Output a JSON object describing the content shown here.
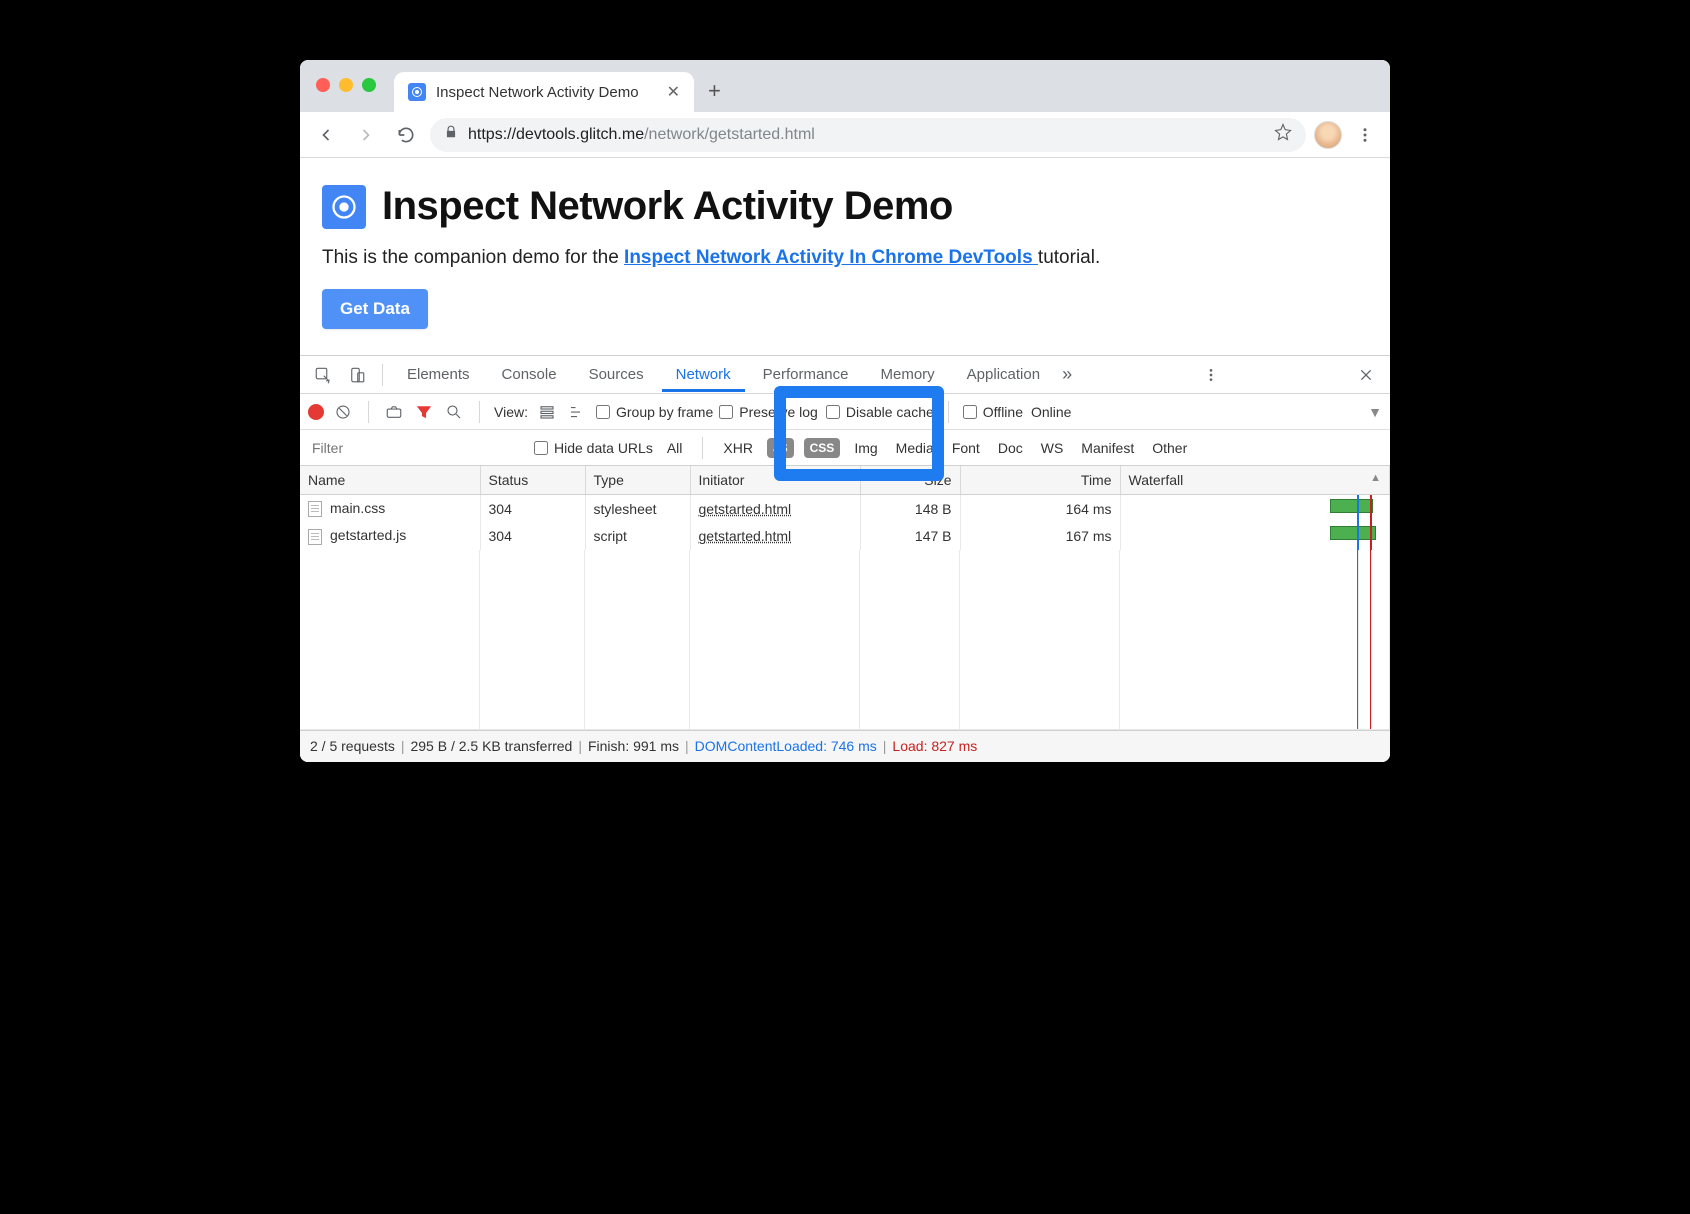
{
  "browser": {
    "tab_title": "Inspect Network Activity Demo",
    "url_host": "https://devtools.glitch.me",
    "url_path": "/network/getstarted.html"
  },
  "page": {
    "heading": "Inspect Network Activity Demo",
    "intro_prefix": "This is the companion demo for the ",
    "intro_link": "Inspect Network Activity In Chrome DevTools ",
    "intro_suffix": "tutorial.",
    "button_label": "Get Data"
  },
  "devtools": {
    "tabs": [
      "Elements",
      "Console",
      "Sources",
      "Network",
      "Performance",
      "Memory",
      "Application"
    ],
    "active_tab": "Network",
    "controls": {
      "view_label": "View:",
      "group_by_frame": "Group by frame",
      "preserve_log": "Preserve log",
      "disable_cache": "Disable cache",
      "offline": "Offline",
      "online": "Online"
    },
    "filters": {
      "placeholder": "Filter",
      "hide_data_urls": "Hide data URLs",
      "types": [
        "All",
        "XHR",
        "JS",
        "CSS",
        "Img",
        "Media",
        "Font",
        "Doc",
        "WS",
        "Manifest",
        "Other"
      ],
      "selected": [
        "JS",
        "CSS"
      ]
    },
    "columns": [
      "Name",
      "Status",
      "Type",
      "Initiator",
      "Size",
      "Time",
      "Waterfall"
    ],
    "rows": [
      {
        "name": "main.css",
        "status": "304",
        "type": "stylesheet",
        "initiator": "getstarted.html",
        "size": "148 B",
        "time": "164 ms"
      },
      {
        "name": "getstarted.js",
        "status": "304",
        "type": "script",
        "initiator": "getstarted.html",
        "size": "147 B",
        "time": "167 ms"
      }
    ],
    "status": {
      "requests": "2 / 5 requests",
      "transferred": "295 B / 2.5 KB transferred",
      "finish": "Finish: 991 ms",
      "dcl": "DOMContentLoaded: 746 ms",
      "load": "Load: 827 ms"
    }
  }
}
